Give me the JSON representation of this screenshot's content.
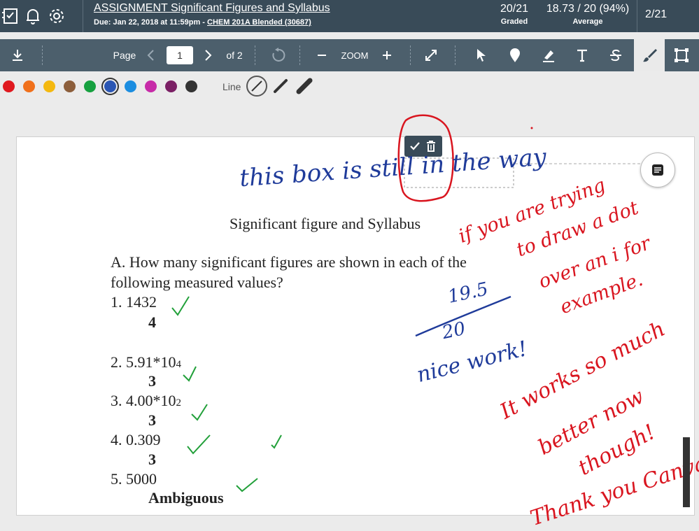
{
  "header": {
    "title": "ASSIGNMENT Significant Figures and Syllabus",
    "due_prefix": "Due: Jan 22, 2018 at 11:59pm - ",
    "course_link": "CHEM 201A Blended (30687)",
    "graded_value": "20/21",
    "graded_label": "Graded",
    "average_value": "18.73 / 20 (94%)",
    "average_label": "Average",
    "student_position": "2/21"
  },
  "toolbar": {
    "page_label": "Page",
    "page_value": "1",
    "of_label": "of 2",
    "zoom_label": "ZOOM"
  },
  "palette": {
    "colors": [
      "#e0191f",
      "#f0701b",
      "#f4b80f",
      "#8c5e3b",
      "#16a03f",
      "#2a56b4",
      "#1b8de0",
      "#c72ba8",
      "#7a1f64",
      "#333333"
    ],
    "selected": "#2a56b4",
    "line_label": "Line"
  },
  "document": {
    "title": "Significant figure and Syllabus",
    "question_line1": "A. How many significant figures are shown in each of the",
    "question_line2": "following measured values?",
    "items": [
      {
        "q": "1. 1432",
        "a": "4"
      },
      {
        "q": "2. 5.91*10",
        "sup": "4",
        "a": "3"
      },
      {
        "q": "3. 4.00*10",
        "sup": "2",
        "a": "3"
      },
      {
        "q": "4. 0.309",
        "a": "3"
      },
      {
        "q": "5. 5000",
        "a": "Ambiguous"
      }
    ]
  },
  "annotations": {
    "box_text": "this box is still in the way",
    "score_num": "19.5",
    "score_den": "20",
    "praise": "nice work!",
    "red_note1": [
      "if you are trying",
      "to draw a dot",
      "over an i for",
      "example."
    ],
    "red_note2": [
      "It works so much",
      "better now",
      "though!",
      "Thank you Canvas!"
    ]
  }
}
